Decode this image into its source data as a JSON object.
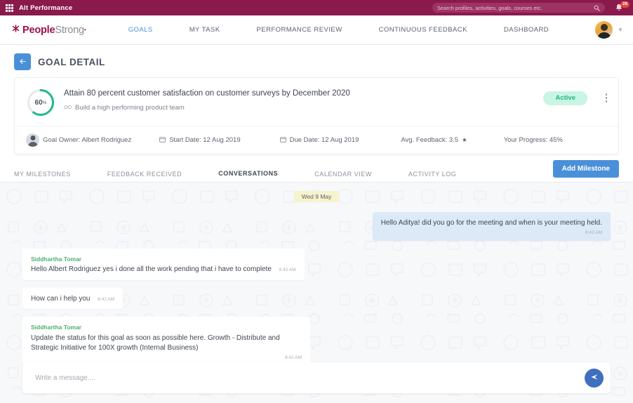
{
  "topbar": {
    "app_name": "Alt Performance",
    "grid_icon": "grid-apps-icon",
    "search": {
      "placeholder": "Search profiles, activities, goals, courses etc.",
      "value": "",
      "icon": "search-icon"
    },
    "notifications": {
      "icon": "bell-icon",
      "count": "26"
    },
    "colors": {
      "bar": "#8a1a4c",
      "badge": "#e8453c"
    }
  },
  "navbar": {
    "logo": {
      "primary": "People",
      "secondary": "Strong",
      "tm": "•",
      "mark": "asterisk-icon"
    },
    "items": [
      {
        "label": "GOALS",
        "active": true
      },
      {
        "label": "MY TASK",
        "active": false
      },
      {
        "label": "PERFORMANCE REVIEW",
        "active": false
      },
      {
        "label": "CONTINUOUS FEEDBACK",
        "active": false
      },
      {
        "label": "DASHBOARD",
        "active": false
      }
    ],
    "profile": {
      "avatar": "user-avatar",
      "chevron": "chevron-down-icon"
    },
    "active_color": "#4a90d9"
  },
  "page": {
    "back_icon": "arrow-left-icon",
    "title": "GOAL DETAIL"
  },
  "goal": {
    "progress_ring": {
      "value": "60",
      "suffix": "%",
      "color": "#1fb98b",
      "track": "#e6e9ec"
    },
    "title": "Attain 80 percent customer satisfaction on customer surveys by December 2020",
    "linked_icon": "link-icon",
    "linked_goal": "Build a high performing product team",
    "status": "Active",
    "status_color": "#22b783",
    "status_bg": "#c9f5e4",
    "kebab_icon": "more-vertical-icon",
    "meta": {
      "owner_label": "Goal Owner: Albert Rodriguez",
      "owner_avatar": "owner-avatar",
      "start_icon": "calendar-icon",
      "start_label": "Start Date: 12 Aug 2019",
      "due_icon": "calendar-icon",
      "due_label": "Due Date: 12 Aug 2019",
      "feedback_label": "Avg. Feedback: 3.5",
      "feedback_star": "★",
      "progress_label": "Your Progress: 45%"
    }
  },
  "tabs": {
    "items": [
      {
        "label": "MY MILESTONES",
        "active": false
      },
      {
        "label": "FEEDBACK RECEIVED",
        "active": false
      },
      {
        "label": "CONVERSATIONS",
        "active": true
      },
      {
        "label": "CALENDAR VIEW",
        "active": false
      },
      {
        "label": "ACTIVITY LOG",
        "active": false
      }
    ],
    "add_milestone": "Add Milestone"
  },
  "chat": {
    "date_divider": "Wed 9 May",
    "messages": [
      {
        "direction": "out",
        "sender": "",
        "text": "Hello Aditya! did you go for the meeting and when is your meeting held.",
        "time": "8:42 AM"
      },
      {
        "direction": "in",
        "sender": "Siddhartha Tomar",
        "text": "Hello Albert Rodriguez yes i done all the work pending that i have to complete",
        "time": "8:42 AM"
      },
      {
        "direction": "in",
        "sender": "",
        "text": "How can i help you",
        "time": "8:42 AM"
      },
      {
        "direction": "in",
        "sender": "Siddhartha Tomar",
        "text": "Update the status for this goal as soon as possible here. Growth - Distribute and Strategic Initiative for 100X growth (Internal Business)",
        "time": "8:42 AM"
      }
    ],
    "composer": {
      "placeholder": "Write a message....",
      "value": "",
      "send_icon": "send-icon"
    }
  }
}
